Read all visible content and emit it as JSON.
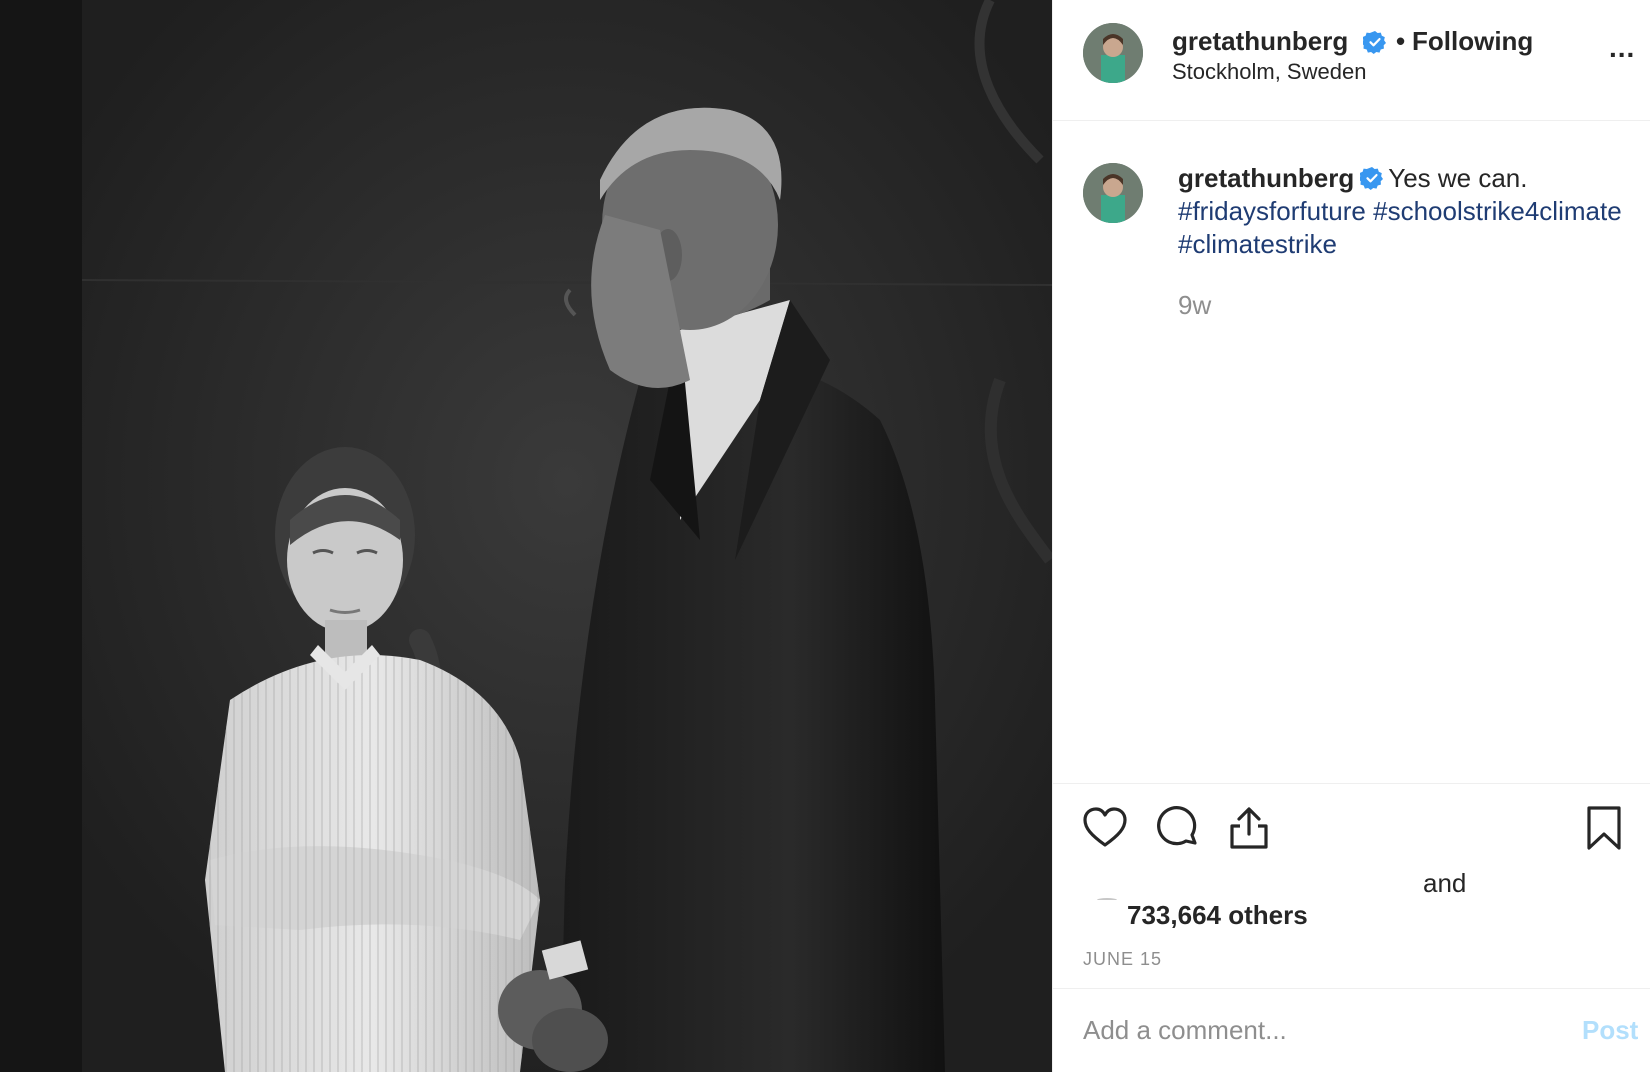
{
  "post": {
    "image": {
      "description_icon": "photo-two-people"
    }
  },
  "header": {
    "username": "gretathunberg",
    "separator": "•",
    "follow_status": "Following",
    "location": "Stockholm, Sweden",
    "more_icon": "more-options-icon",
    "more_label": "..."
  },
  "caption": {
    "username": "gretathunberg",
    "text": "Yes we can.",
    "hashtags": [
      "#fridaysforfuture",
      "#schoolstrike4climate",
      "#climatestrike"
    ],
    "time_ago": "9w"
  },
  "actions": {
    "icons": [
      "heart-icon",
      "comment-icon",
      "share-icon",
      "bookmark-icon"
    ]
  },
  "likes": {
    "and_text": "and",
    "others_text": "733,664 others"
  },
  "date": "JUNE 15",
  "comment": {
    "placeholder": "Add a comment...",
    "post_label": "Post"
  },
  "colors": {
    "verified": "#3897f0",
    "hashtag": "#1f3c73",
    "post_button_disabled": "#b2dffc",
    "muted": "#8e8e8e"
  }
}
